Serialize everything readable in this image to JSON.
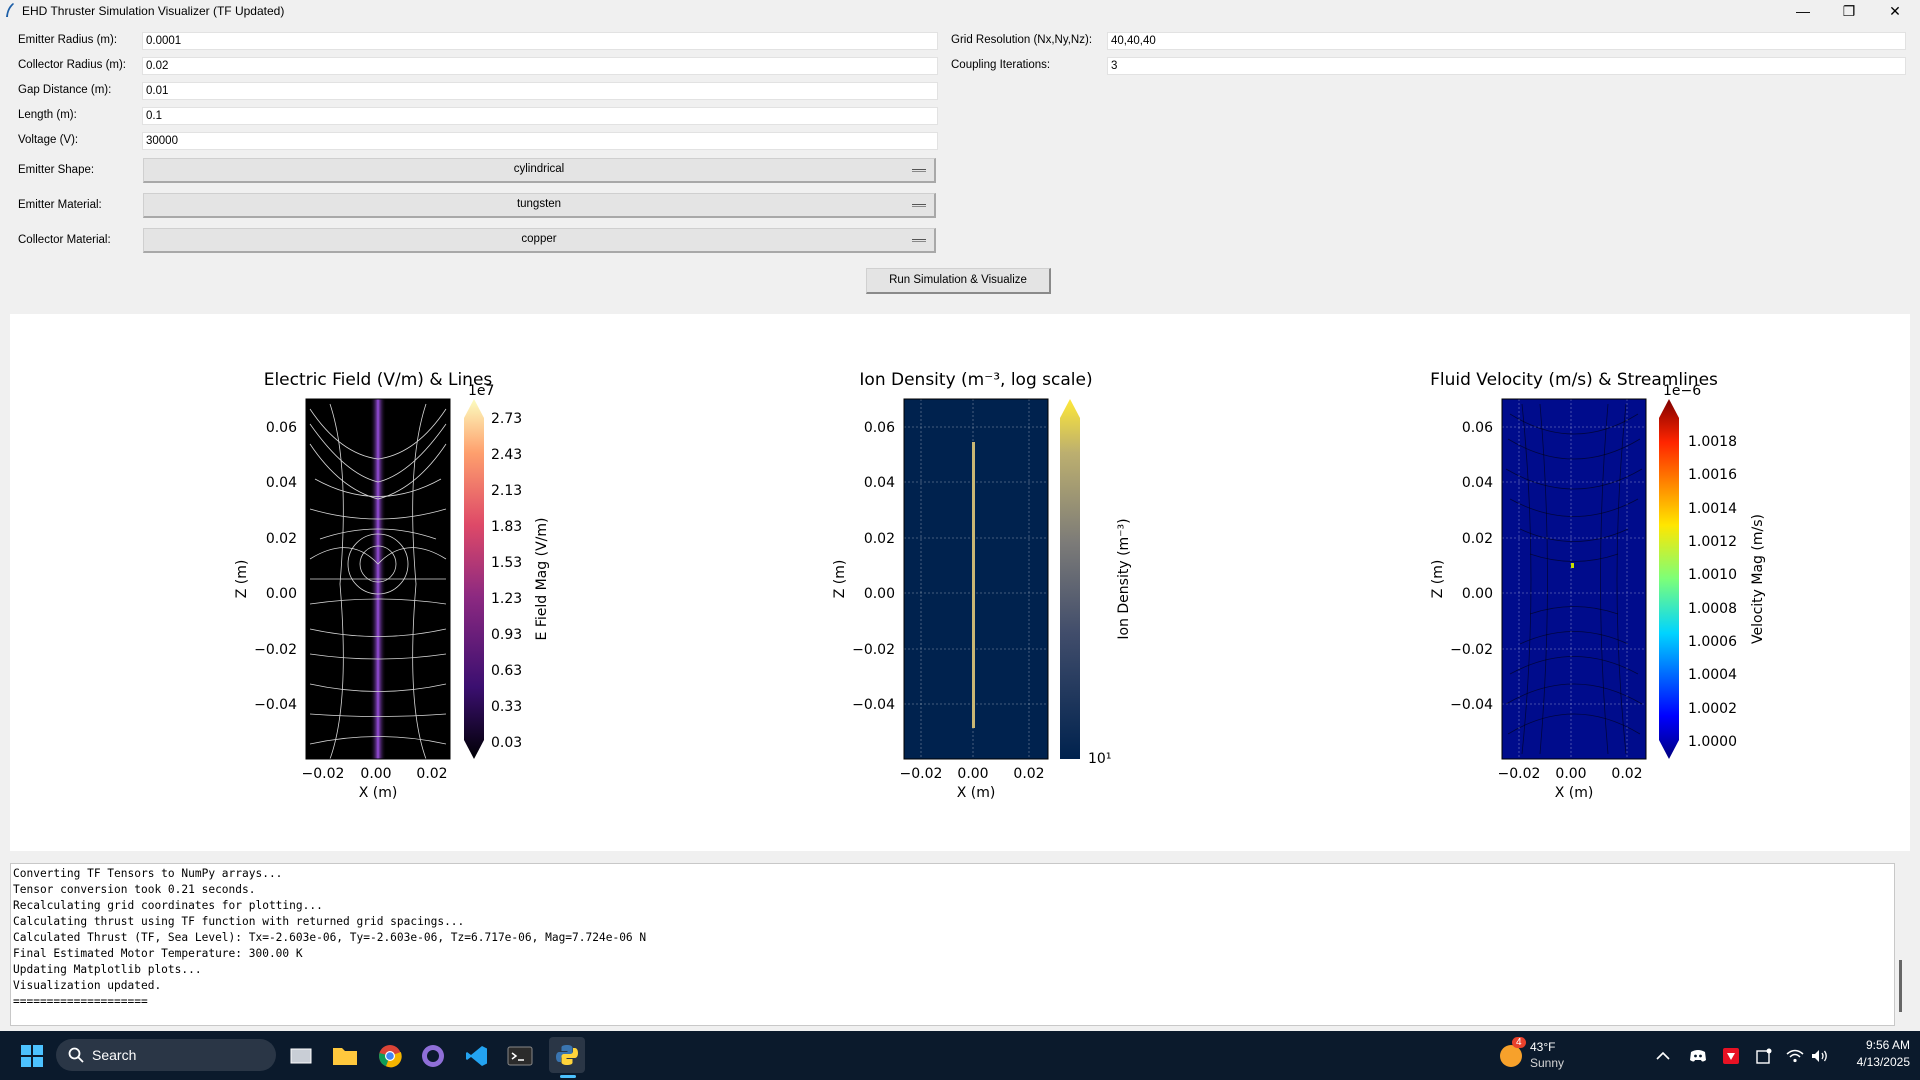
{
  "window": {
    "title": "EHD Thruster Simulation Visualizer (TF Updated)"
  },
  "form": {
    "emitter_radius": {
      "label": "Emitter Radius (m):",
      "value": "0.0001"
    },
    "collector_radius": {
      "label": "Collector Radius (m):",
      "value": "0.02"
    },
    "gap_distance": {
      "label": "Gap Distance (m):",
      "value": "0.01"
    },
    "length": {
      "label": "Length (m):",
      "value": "0.1"
    },
    "voltage": {
      "label": "Voltage (V):",
      "value": "30000"
    },
    "grid_resolution": {
      "label": "Grid Resolution (Nx,Ny,Nz):",
      "value": "40,40,40"
    },
    "coupling_iterations": {
      "label": "Coupling Iterations:",
      "value": "3"
    },
    "emitter_shape": {
      "label": "Emitter Shape:",
      "value": "cylindrical"
    },
    "emitter_material": {
      "label": "Emitter Material:",
      "value": "tungsten"
    },
    "collector_material": {
      "label": "Collector Material:",
      "value": "copper"
    },
    "run_button": "Run Simulation & Visualize"
  },
  "chart_data": [
    {
      "type": "heatmap",
      "title": "Electric Field (V/m) & Lines",
      "xlabel": "X (m)",
      "ylabel": "Z (m)",
      "xticks": [
        "−0.02",
        "0.00",
        "0.02"
      ],
      "yticks": [
        "0.06",
        "0.04",
        "0.02",
        "0.00",
        "−0.02",
        "−0.04"
      ],
      "colorbar": {
        "label": "E Field Mag (V/m)",
        "scale": "1e7",
        "ticks": [
          "2.73",
          "2.43",
          "2.13",
          "1.83",
          "1.53",
          "1.23",
          "0.93",
          "0.63",
          "0.33",
          "0.03"
        ],
        "colormap": "magma"
      }
    },
    {
      "type": "heatmap",
      "title": "Ion Density (m⁻³, log scale)",
      "xlabel": "X (m)",
      "ylabel": "Z (m)",
      "xticks": [
        "−0.02",
        "0.00",
        "0.02"
      ],
      "yticks": [
        "0.06",
        "0.04",
        "0.02",
        "0.00",
        "−0.02",
        "−0.04"
      ],
      "grid": true,
      "colorbar": {
        "label": "Ion Density (m⁻³)",
        "ticks": [
          "10¹"
        ],
        "colormap": "cividis"
      }
    },
    {
      "type": "heatmap",
      "title": "Fluid Velocity (m/s) & Streamlines",
      "xlabel": "X (m)",
      "ylabel": "Z (m)",
      "xticks": [
        "−0.02",
        "0.00",
        "0.02"
      ],
      "yticks": [
        "0.06",
        "0.04",
        "0.02",
        "0.00",
        "−0.02",
        "−0.04"
      ],
      "grid": true,
      "colorbar": {
        "label": "Velocity Mag (m/s)",
        "scale": "1e−6",
        "ticks": [
          "1.0018",
          "1.0016",
          "1.0014",
          "1.0012",
          "1.0010",
          "1.0008",
          "1.0006",
          "1.0004",
          "1.0002",
          "1.0000"
        ],
        "colormap": "jet"
      }
    }
  ],
  "log": {
    "lines": [
      "Converting TF Tensors to NumPy arrays...",
      "Tensor conversion took 0.21 seconds.",
      "Recalculating grid coordinates for plotting...",
      "Calculating thrust using TF function with returned grid spacings...",
      "Calculated Thrust (TF, Sea Level): Tx=-2.603e-06, Ty=-2.603e-06, Tz=6.717e-06, Mag=7.724e-06 N",
      "Final Estimated Motor Temperature: 300.00 K",
      "Updating Matplotlib plots...",
      "Visualization updated.",
      "===================="
    ]
  },
  "taskbar": {
    "search_label": "Search",
    "weather": {
      "temp": "43°F",
      "condition": "Sunny",
      "badge": "4"
    },
    "time": "9:56 AM",
    "date": "4/13/2025"
  }
}
